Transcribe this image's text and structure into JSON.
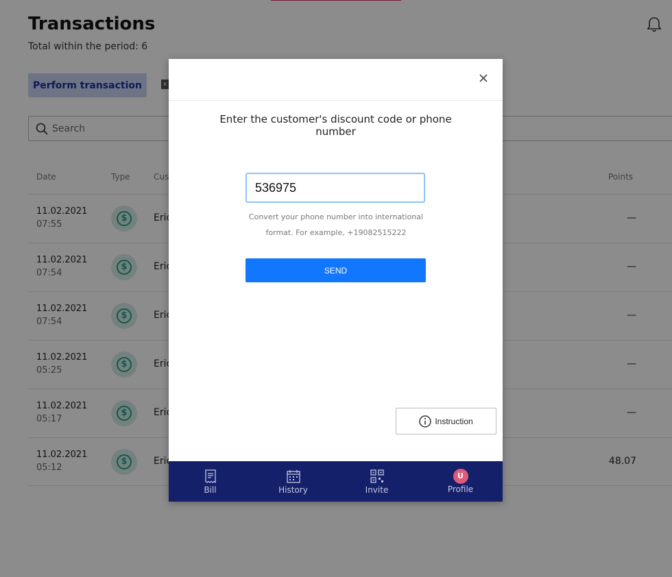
{
  "page": {
    "title": "Transactions",
    "subtitle": "Total within the period: 6",
    "perform_button": "Perform transaction",
    "search_placeholder": "Search",
    "columns": {
      "date": "Date",
      "type": "Type",
      "customer": "Cus",
      "points": "Points"
    },
    "rows": [
      {
        "date": "11.02.2021",
        "time": "07:55",
        "customer": "Eric",
        "points": "—"
      },
      {
        "date": "11.02.2021",
        "time": "07:54",
        "customer": "Eric",
        "points": "—"
      },
      {
        "date": "11.02.2021",
        "time": "07:54",
        "customer": "Eric",
        "points": "—"
      },
      {
        "date": "11.02.2021",
        "time": "05:25",
        "customer": "Eric",
        "points": "—"
      },
      {
        "date": "11.02.2021",
        "time": "05:17",
        "customer": "Eric",
        "points": "—"
      },
      {
        "date": "11.02.2021",
        "time": "05:12",
        "customer": "Eric",
        "points": "48.07"
      }
    ],
    "type_icon": "dollar-icon"
  },
  "modal": {
    "prompt": "Enter the customer's discount code or phone number",
    "input_value": "536975",
    "hint": "Convert your phone number into international format. For example, +19082515222",
    "send_label": "SEND",
    "instruction_label": "Instruction",
    "nav": [
      {
        "label": "Bill",
        "icon": "receipt-icon"
      },
      {
        "label": "History",
        "icon": "calendar-icon"
      },
      {
        "label": "Invite",
        "icon": "qr-code-icon"
      },
      {
        "label": "Profile",
        "icon": "avatar",
        "avatar_letter": "U"
      }
    ]
  },
  "colors": {
    "accent": "#1177ff",
    "nav_bg": "#15206a",
    "perform_bg": "#c9d3f5",
    "avatar": "#e05a7a",
    "type_icon": "#21a088"
  }
}
